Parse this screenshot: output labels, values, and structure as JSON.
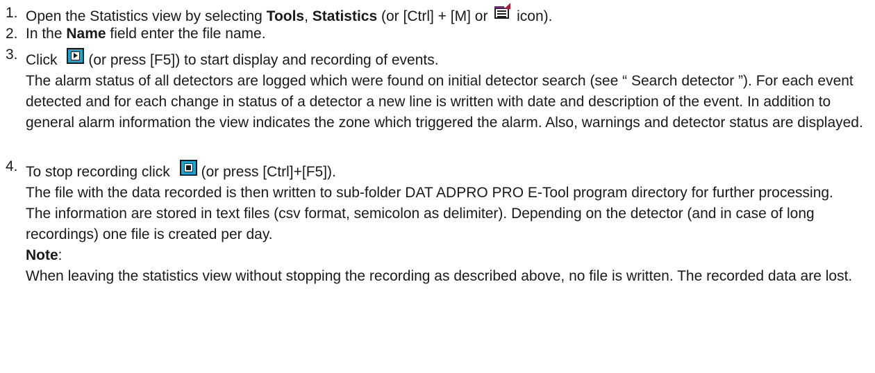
{
  "steps": [
    {
      "number": "1.",
      "text_before": "Open the Statistics view by selecting ",
      "menu_tools": "Tools",
      "comma": ", ",
      "menu_statistics": "Statistics",
      "text_middle": " (or [Ctrl] + [M] or ",
      "icon": "statistics-icon",
      "text_after": " icon)."
    },
    {
      "number": "2.",
      "text_before": "In the ",
      "field_name": "Name",
      "text_after": " field enter the file name."
    },
    {
      "number": "3.",
      "text_before": "Click ",
      "icon": "play-button-icon",
      "text_after": "(or press [F5]) to start display and recording of events.",
      "paragraph": "The alarm status of all detectors are logged which were found on initial detector search (see “ Search detector ”). For each event detected and for each change in status of a detector a new line is written with date and description of the event. In addition to general alarm information the view indicates the zone which triggered the alarm. Also, warnings and detector status are displayed."
    },
    {
      "number": "4.",
      "text_before": "To stop recording click ",
      "icon": "stop-button-icon",
      "text_after": "(or press [Ctrl]+[F5]).",
      "paragraph_1": "The file with the data recorded is then written to sub-folder DAT ADPRO PRO E-Tool program directory for further processing.",
      "paragraph_2": "The information are stored in text files (csv format, semicolon as delimiter). Depending on the detector (and in case of long recordings) one file is created per day.",
      "note_label": "Note",
      "note_colon": ":",
      "note_text": "When leaving the statistics view without stopping the recording as described above, no file is written. The recorded data are lost."
    }
  ],
  "colors": {
    "text": "#1a1a1a",
    "button_icon_fill": "#13a7d4",
    "stats_icon_accent": "#b0183a"
  }
}
